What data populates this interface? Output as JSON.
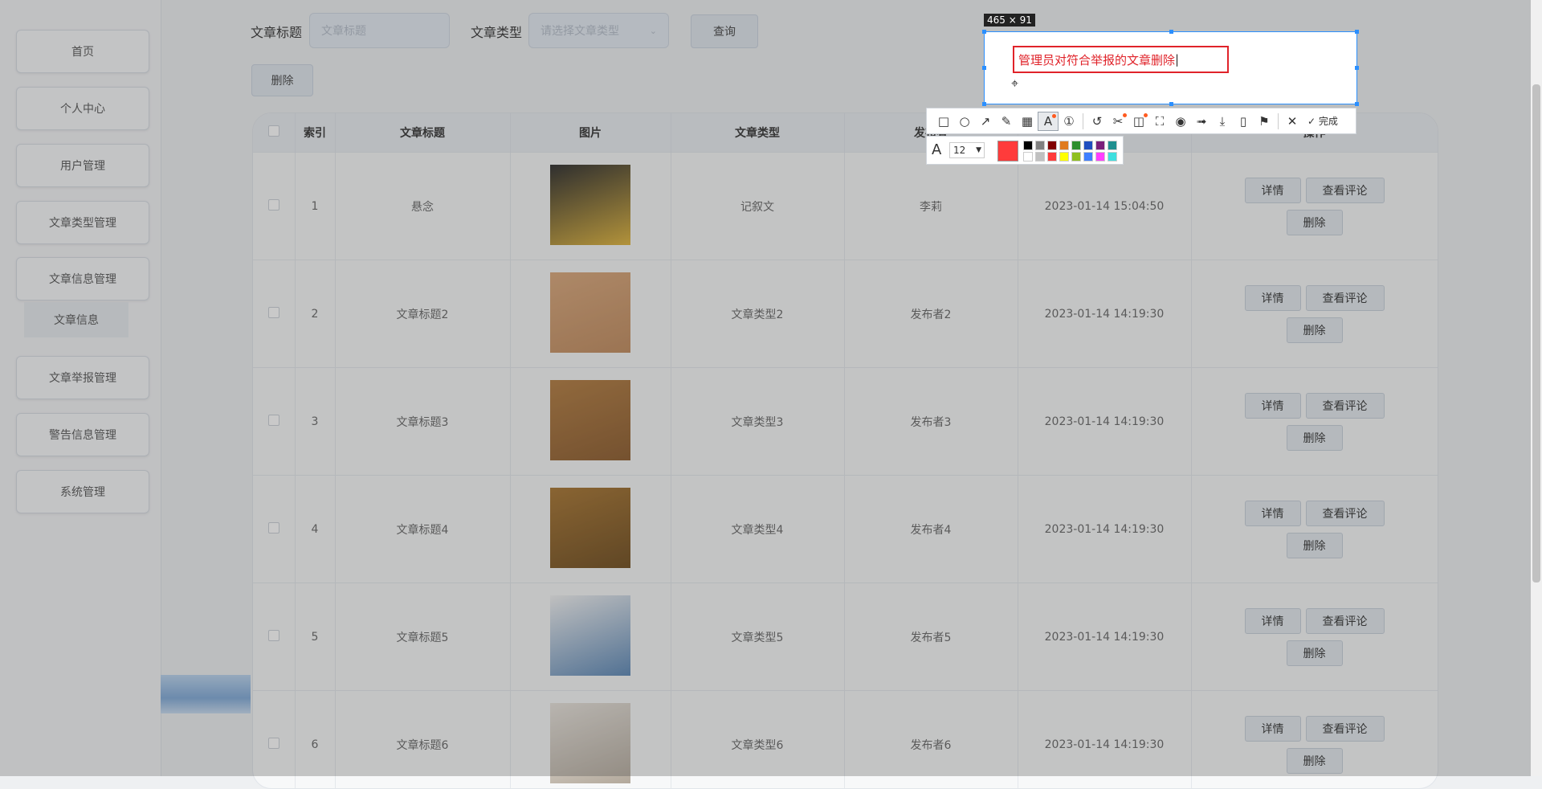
{
  "sidebar": {
    "items": [
      {
        "label": "首页"
      },
      {
        "label": "个人中心"
      },
      {
        "label": "用户管理"
      },
      {
        "label": "文章类型管理"
      },
      {
        "label": "文章信息管理"
      },
      {
        "label": "文章举报管理"
      },
      {
        "label": "警告信息管理"
      },
      {
        "label": "系统管理"
      }
    ],
    "submenu": {
      "label": "文章信息"
    }
  },
  "search": {
    "title_label": "文章标题",
    "title_placeholder": "文章标题",
    "type_label": "文章类型",
    "type_placeholder": "请选择文章类型",
    "query_button": "查询",
    "delete_button": "删除"
  },
  "table": {
    "headers": [
      "",
      "索引",
      "文章标题",
      "图片",
      "文章类型",
      "发布者",
      "",
      "操作"
    ],
    "rows": [
      {
        "index": "1",
        "title": "悬念",
        "type": "记叙文",
        "publisher": "李莉",
        "time": "2023-01-14 15:04:50"
      },
      {
        "index": "2",
        "title": "文章标题2",
        "type": "文章类型2",
        "publisher": "发布者2",
        "time": "2023-01-14 14:19:30"
      },
      {
        "index": "3",
        "title": "文章标题3",
        "type": "文章类型3",
        "publisher": "发布者3",
        "time": "2023-01-14 14:19:30"
      },
      {
        "index": "4",
        "title": "文章标题4",
        "type": "文章类型4",
        "publisher": "发布者4",
        "time": "2023-01-14 14:19:30"
      },
      {
        "index": "5",
        "title": "文章标题5",
        "type": "文章类型5",
        "publisher": "发布者5",
        "time": "2023-01-14 14:19:30"
      },
      {
        "index": "6",
        "title": "文章标题6",
        "type": "文章类型6",
        "publisher": "发布者6",
        "time": "2023-01-14 14:19:30"
      }
    ],
    "actions": {
      "detail": "详情",
      "comments": "查看评论",
      "delete": "删除"
    }
  },
  "screenshot_tool": {
    "size_label": "465 × 91",
    "annotation_text": "管理员对符合举报的文章删除",
    "font_size": "12",
    "done_label": "完成",
    "current_color": "#ff3b3b",
    "palette_row1": [
      "#000000",
      "#808080",
      "#800000",
      "#e07b1f",
      "#2f8f2f",
      "#1f4fbf",
      "#7a1f7a",
      "#1f8f8f"
    ],
    "palette_row2": [
      "#ffffff",
      "#c0c0c0",
      "#ff3b3b",
      "#ffff00",
      "#8fbf1f",
      "#3f7fff",
      "#ff3fff",
      "#3fdfdf"
    ],
    "tools": [
      "rectangle-tool",
      "ellipse-tool",
      "arrow-tool",
      "pen-tool",
      "mosaic-tool",
      "text-tool",
      "number-tool",
      "undo-tool",
      "cut-tool",
      "ocr-tool",
      "scan-tool",
      "pin-tool",
      "record-tool",
      "save-tool",
      "phone-tool",
      "bookmark-tool",
      "close-tool"
    ]
  }
}
